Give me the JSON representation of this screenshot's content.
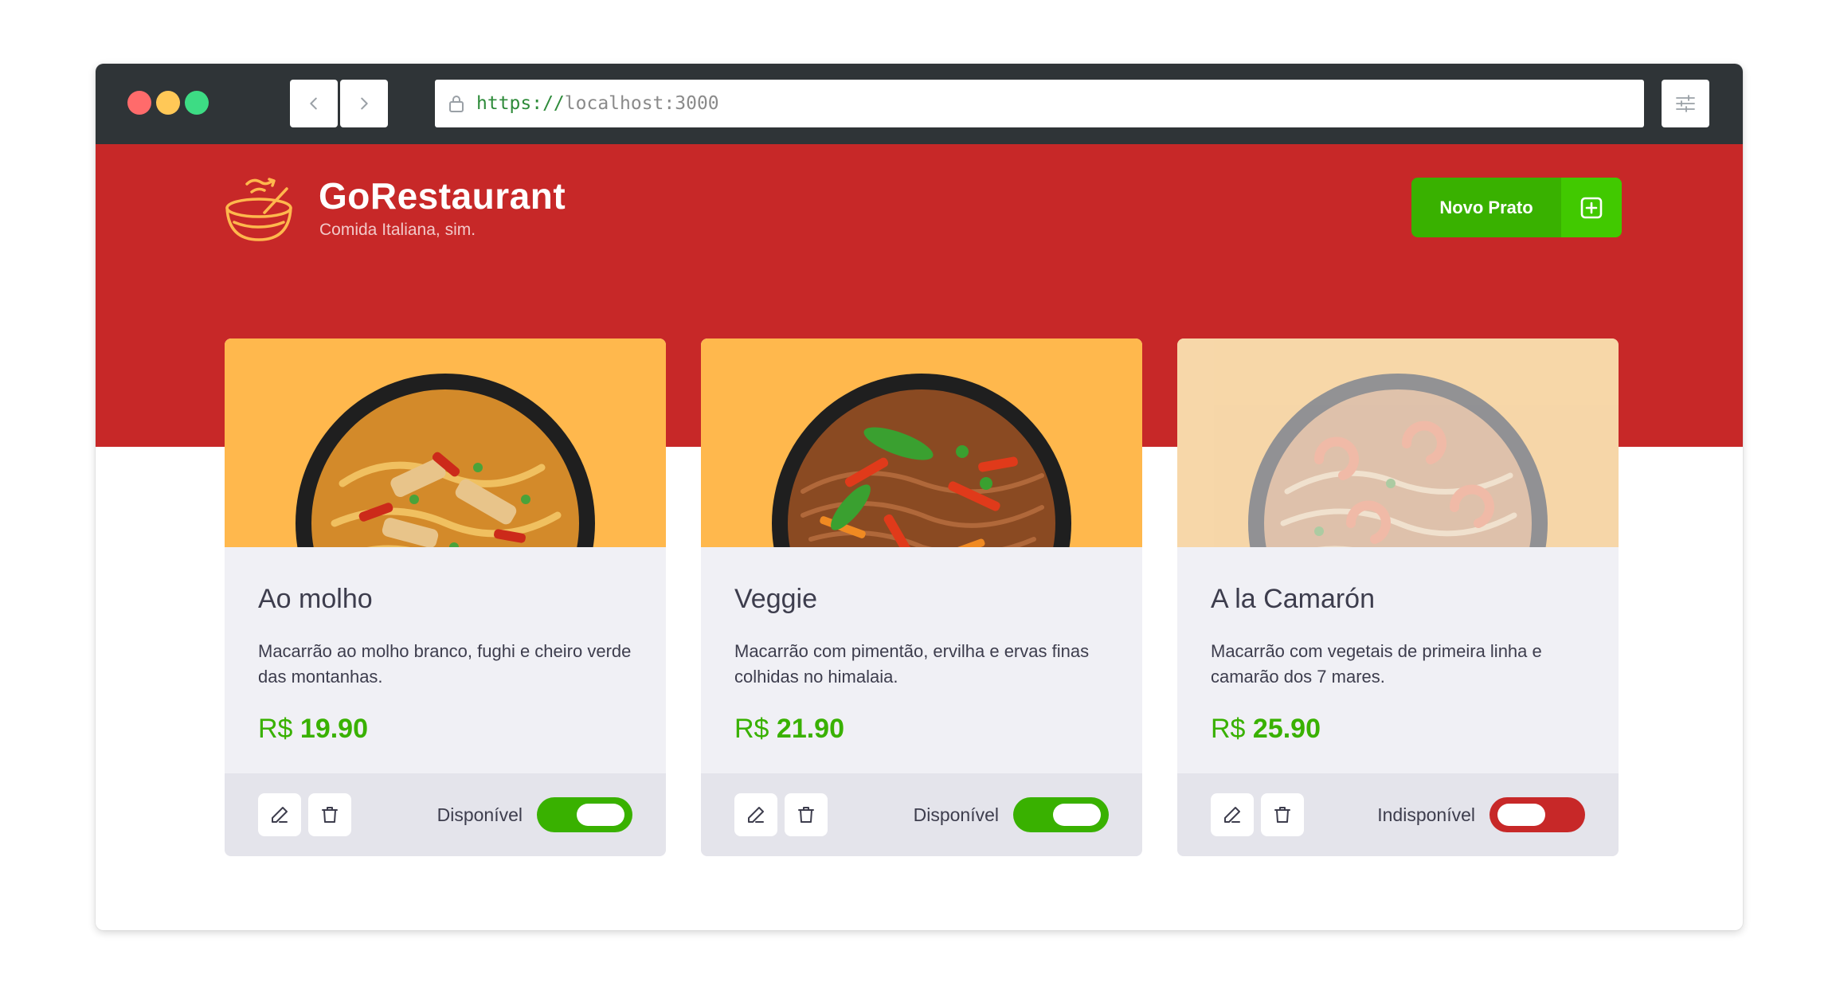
{
  "browser": {
    "url_scheme": "https://",
    "url_host": "localhost:3000"
  },
  "header": {
    "brand": "GoRestaurant",
    "tagline": "Comida Italiana, sim.",
    "new_button_label": "Novo Prato"
  },
  "colors": {
    "hero": "#c72828",
    "accent_green": "#39b100",
    "card_image_bg": "#ffb84d",
    "card_body": "#f0f0f5"
  },
  "foods": [
    {
      "name": "Ao molho",
      "description": "Macarrão ao molho branco, fughi e cheiro verde das montanhas.",
      "currency": "R$",
      "price": "19.90",
      "status": "Disponível",
      "available": true
    },
    {
      "name": "Veggie",
      "description": "Macarrão com pimentão, ervilha e ervas finas colhidas no himalaia.",
      "currency": "R$",
      "price": "21.90",
      "status": "Disponível",
      "available": true
    },
    {
      "name": "A la Camarón",
      "description": "Macarrão com vegetais de primeira linha e camarão dos 7 mares.",
      "currency": "R$",
      "price": "25.90",
      "status": "Indisponível",
      "available": false
    }
  ],
  "icons": {
    "browser": [
      "chevron-left-icon",
      "chevron-right-icon",
      "lock-icon",
      "sliders-icon"
    ],
    "header": [
      "bowl-logo-icon",
      "plus-square-icon"
    ],
    "card_actions": [
      "edit-icon",
      "trash-icon"
    ]
  }
}
